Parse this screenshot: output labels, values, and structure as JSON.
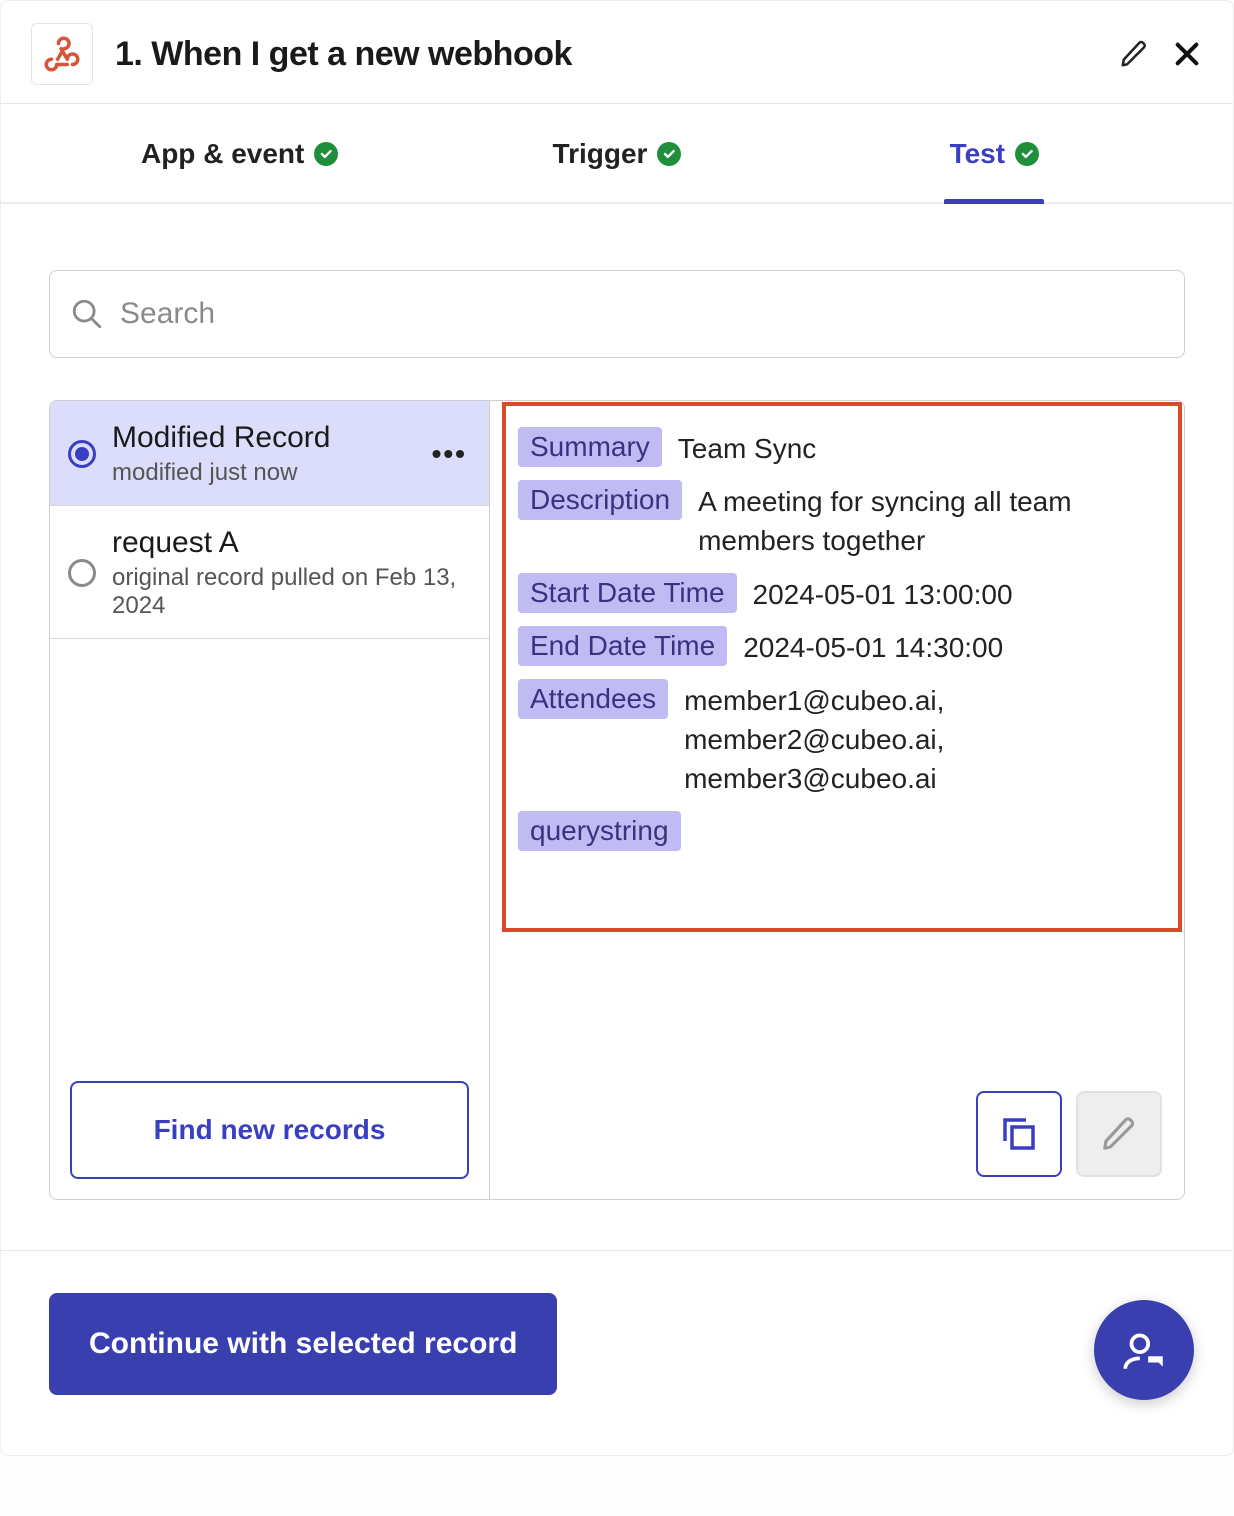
{
  "header": {
    "title": "1. When I get a new webhook"
  },
  "tabs": [
    {
      "label": "App & event",
      "complete": true,
      "active": false
    },
    {
      "label": "Trigger",
      "complete": true,
      "active": false
    },
    {
      "label": "Test",
      "complete": true,
      "active": true
    }
  ],
  "search": {
    "placeholder": "Search"
  },
  "records": [
    {
      "title": "Modified Record",
      "subtitle": "modified just now",
      "selected": true,
      "has_menu": true
    },
    {
      "title": "request A",
      "subtitle": "original record pulled on Feb 13, 2024",
      "selected": false,
      "has_menu": false
    }
  ],
  "find_new_label": "Find new records",
  "detail": {
    "fields": [
      {
        "key": "Summary",
        "value": "Team Sync"
      },
      {
        "key": "Description",
        "value": "A meeting for syncing all team members together"
      },
      {
        "key": "Start Date Time",
        "value": "2024-05-01 13:00:00"
      },
      {
        "key": "End Date Time",
        "value": "2024-05-01 14:30:00"
      },
      {
        "key": "Attendees",
        "value": "member1@cubeo.ai, member2@cubeo.ai, member3@cubeo.ai"
      },
      {
        "key": "querystring",
        "value": ""
      }
    ]
  },
  "continue_label": "Continue with selected record"
}
